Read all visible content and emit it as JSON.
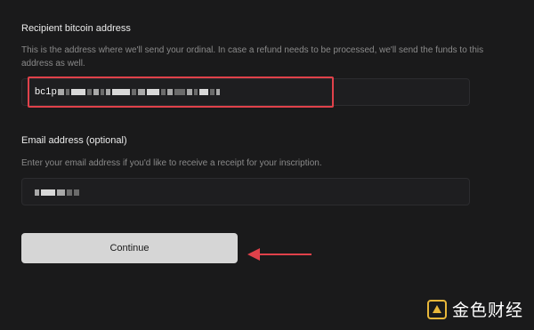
{
  "recipient": {
    "label": "Recipient bitcoin address",
    "help": "This is the address where we'll send your ordinal. In case a refund needs to be processed, we'll send the funds to this address as well.",
    "value_prefix": "bc1p"
  },
  "email": {
    "label": "Email address (optional)",
    "help": "Enter your email address if you'd like to receive a receipt for your inscription."
  },
  "continue_button": {
    "label": "Continue"
  },
  "watermark": {
    "text": "金色财经"
  },
  "colors": {
    "highlight": "#e0414a",
    "arrow": "#e0414a",
    "button": "#d6d6d6"
  }
}
